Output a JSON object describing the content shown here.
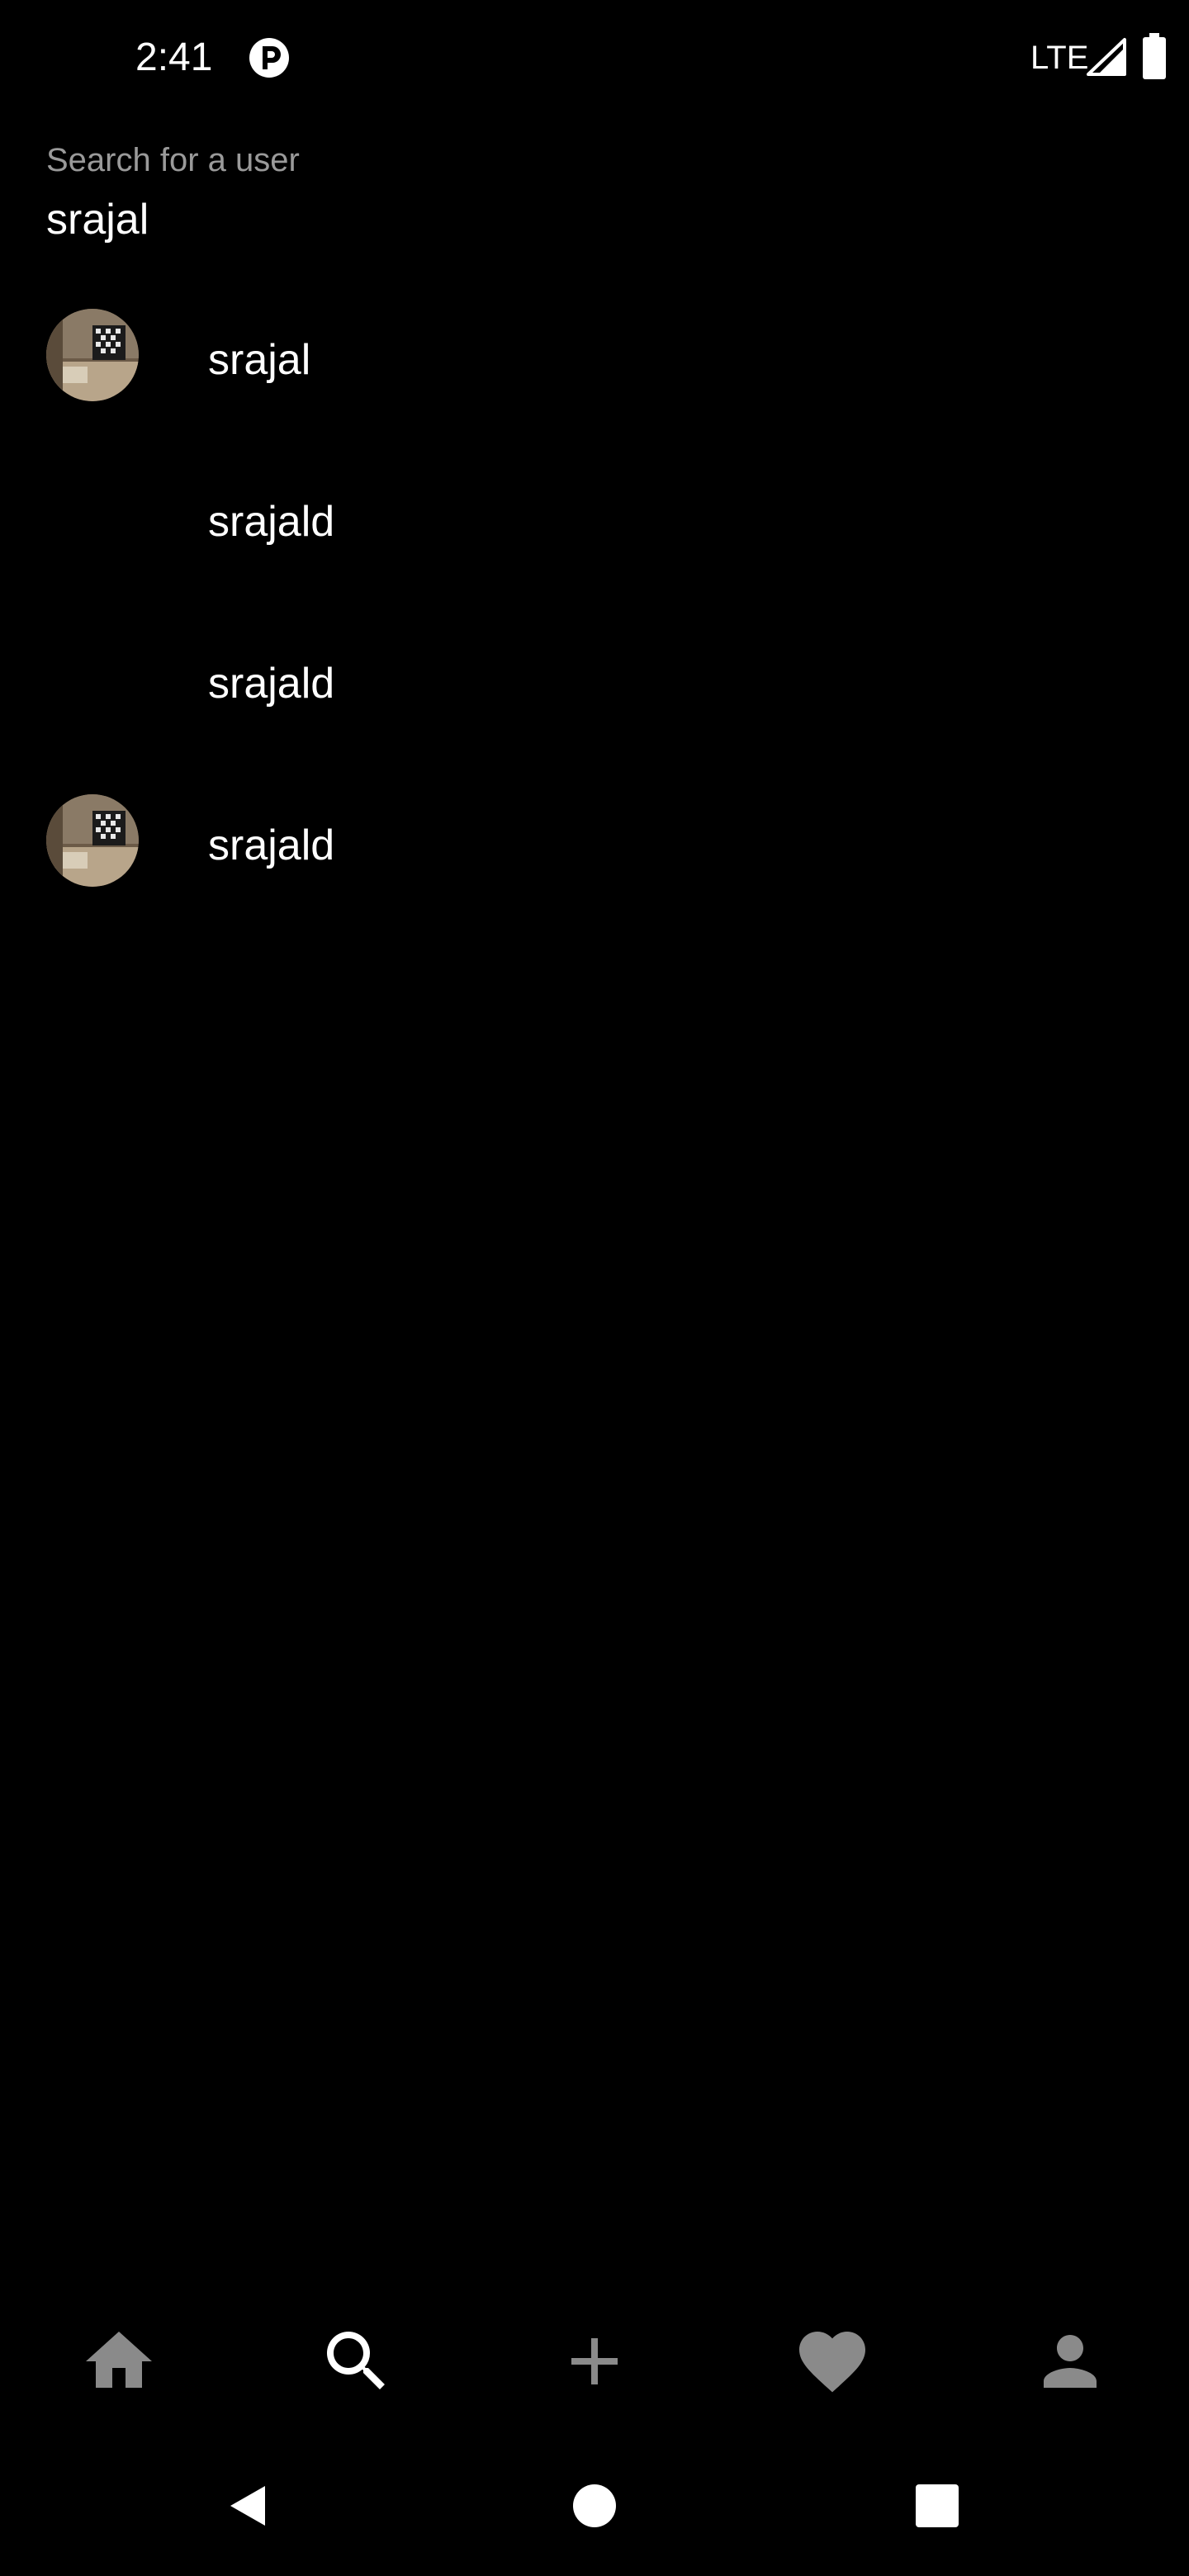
{
  "status_bar": {
    "time": "2:41",
    "network": "LTE",
    "icons": [
      "app-notification-icon",
      "signal-icon",
      "battery-icon"
    ]
  },
  "search": {
    "label": "Search for a user",
    "value": "srajal"
  },
  "results": [
    {
      "username": "srajal",
      "has_avatar": true
    },
    {
      "username": "srajald",
      "has_avatar": false
    },
    {
      "username": "srajald",
      "has_avatar": false
    },
    {
      "username": "srajald",
      "has_avatar": true
    }
  ],
  "bottom_nav": {
    "items": [
      {
        "icon": "home-icon",
        "active": false
      },
      {
        "icon": "search-icon",
        "active": true
      },
      {
        "icon": "add-icon",
        "active": false
      },
      {
        "icon": "heart-icon",
        "active": false
      },
      {
        "icon": "profile-icon",
        "active": false
      }
    ]
  },
  "system_nav": {
    "items": [
      "back-icon",
      "home-circle-icon",
      "recents-icon"
    ]
  },
  "colors": {
    "background": "#000000",
    "text_primary": "#ffffff",
    "text_secondary": "#9a9a9a",
    "nav_inactive": "#8a8a8a",
    "nav_active": "#ffffff"
  }
}
